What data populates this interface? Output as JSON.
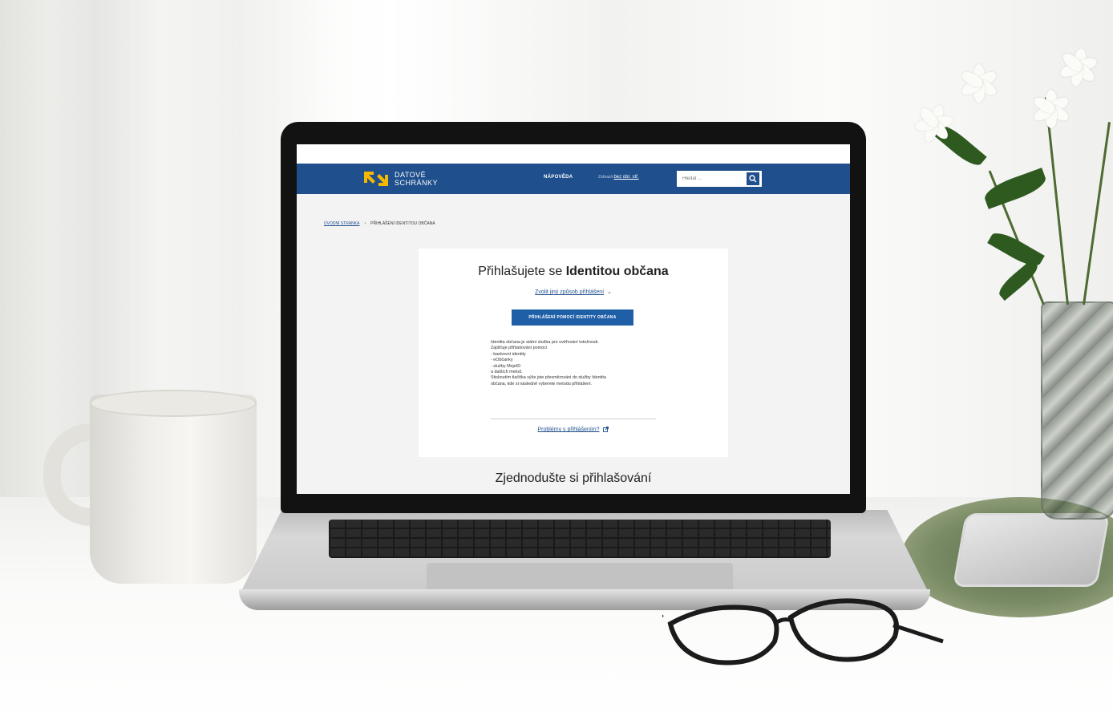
{
  "site": {
    "logo_line1": "DATOVÉ",
    "logo_line2": "SCHRÁNKY",
    "nav_help": "NÁPOVĚDA",
    "nav_accessible_prefix": "Zobrazit",
    "nav_accessible_link": "bez obr. stř.",
    "search_placeholder": "Hledat ...",
    "brand_color": "#1f4f8c",
    "accent_color": "#f5b800"
  },
  "breadcrumb": {
    "home": "ÚVODNÍ STRÁNKA",
    "separator": "›",
    "current": "PŘIHLÁŠENÍ IDENTITOU OBČANA"
  },
  "login": {
    "title_prefix": "Přihlašujete se",
    "title_bold": "Identitou občana",
    "choose_other": "Zvolit jiný způsob přihlášení",
    "primary_button": "PŘIHLÁŠENÍ POMOCÍ IDENTITY OBČANA",
    "info_lines": [
      "Identita občana je státní služba pro ověřování totožnosti.",
      "Zajišťuje přihlašování pomocí",
      "- bankovní identity",
      "- eObčanky",
      "- služby MojeID",
      "a dalších metod.",
      "Stisknutím tlačítka výše jste přesměrováni do služby Identita",
      "občana, kde si následně vyberete metodu přihlášení."
    ],
    "problems_link": "Problémy s přihlášením?"
  },
  "bottom": {
    "heading": "Zjednodušte si přihlašování"
  },
  "icons": {
    "search": "search-icon",
    "chevron": "chevron-down-icon",
    "external": "external-link-icon",
    "logo": "datove-schranky-logo-icon"
  }
}
